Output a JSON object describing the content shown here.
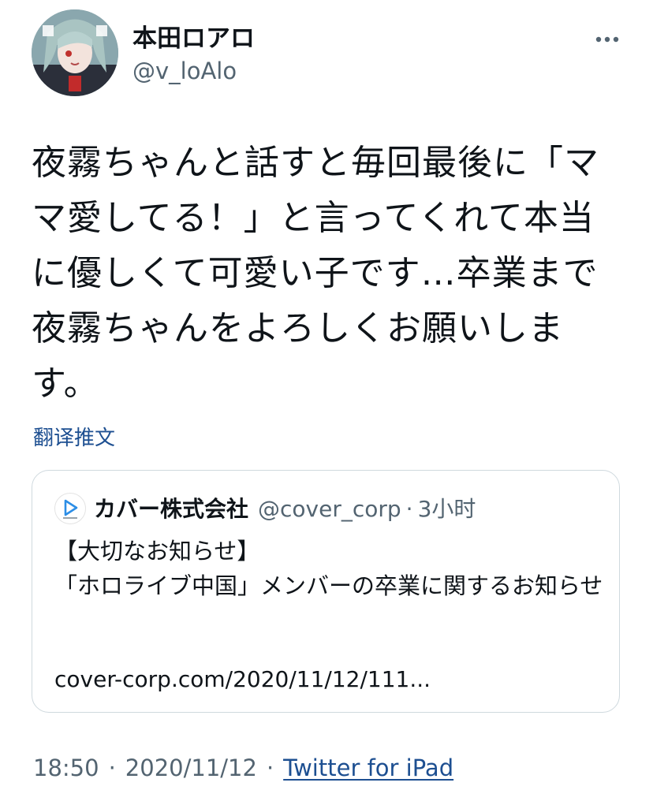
{
  "author": {
    "display_name": "本田ロアロ",
    "handle": "@v_loAlo",
    "avatar_icon": "avatar-image"
  },
  "menu": {
    "more_icon": "more-horizontal-icon"
  },
  "tweet": {
    "text": "夜霧ちゃんと話すと毎回最後に「ママ愛してる！」と言ってくれて本当に優しくて可愛い子です…卒業まで夜霧ちゃんをよろしくお願いします。",
    "translate_label": "翻译推文"
  },
  "quote": {
    "logo_icon": "cover-logo-icon",
    "name": "カバー株式会社",
    "handle": "@cover_corp",
    "separator": "·",
    "time": "3小时",
    "text": "【大切なお知らせ】\n「ホロライブ中国」メンバーの卒業に関するお知らせ",
    "link": "cover-corp.com/2020/11/12/111..."
  },
  "meta": {
    "time": "18:50",
    "separator": "·",
    "date": "2020/11/12",
    "source": "Twitter for iPad"
  },
  "colors": {
    "link": "#1d4f91",
    "secondary_text": "#536471",
    "border": "#cfd9de",
    "logo_blue": "#2c8ee6"
  }
}
